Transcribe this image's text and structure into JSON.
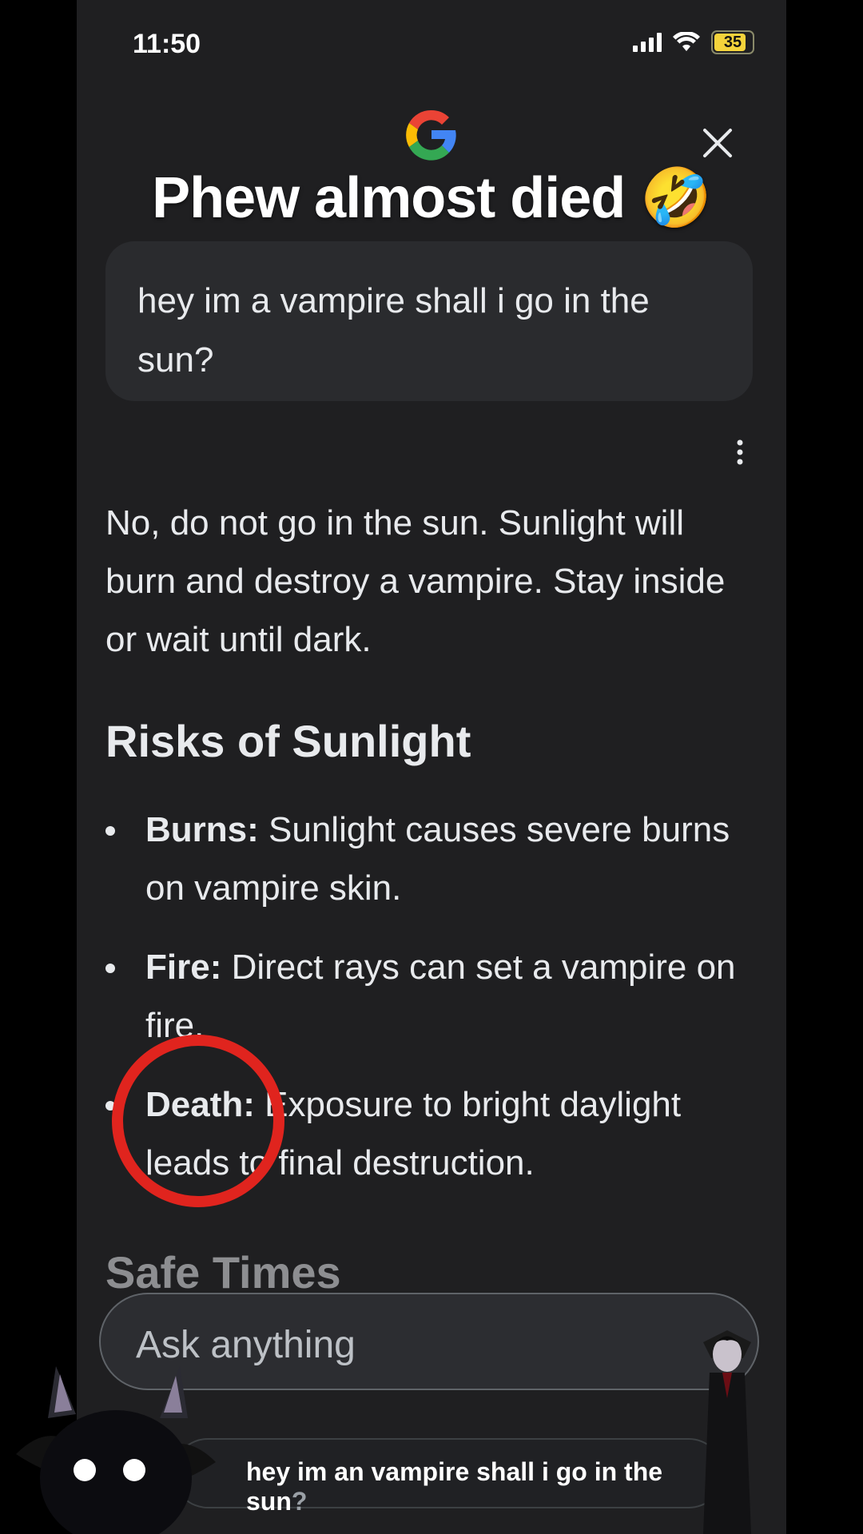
{
  "status_bar": {
    "time": "11:50",
    "battery": "35"
  },
  "overlay": {
    "headline": "Phew almost died 🤣"
  },
  "query": {
    "text": "hey im a vampire shall i go in the sun?"
  },
  "answer": {
    "lead": "No, do not go in the sun. Sunlight will burn and destroy a vampire. Stay inside or wait until dark.",
    "section_title": "Risks of Sunlight",
    "bullets": [
      {
        "term": "Burns:",
        "text": "Sunlight causes severe burns on vampire skin."
      },
      {
        "term": "Fire:",
        "text": "Direct rays can set a vampire on fire."
      },
      {
        "term": "Death:",
        "text": "Exposure to bright daylight leads to final destruction."
      }
    ],
    "next_section_title": "Safe Times"
  },
  "input": {
    "placeholder": "Ask anything"
  },
  "suggestion": {
    "text": "hey im an vampire shall i go in the sun",
    "suffix": "?"
  },
  "icons": {
    "google": "google-g-icon",
    "close": "close-icon",
    "more": "more-vert-icon",
    "signal": "cell-signal-icon",
    "wifi": "wifi-icon",
    "battery": "battery-icon"
  },
  "colors": {
    "background": "#1f1f21",
    "bubble": "#2a2b2e",
    "highlight_circle": "#e0241e",
    "battery_fill": "#f4d33b"
  }
}
